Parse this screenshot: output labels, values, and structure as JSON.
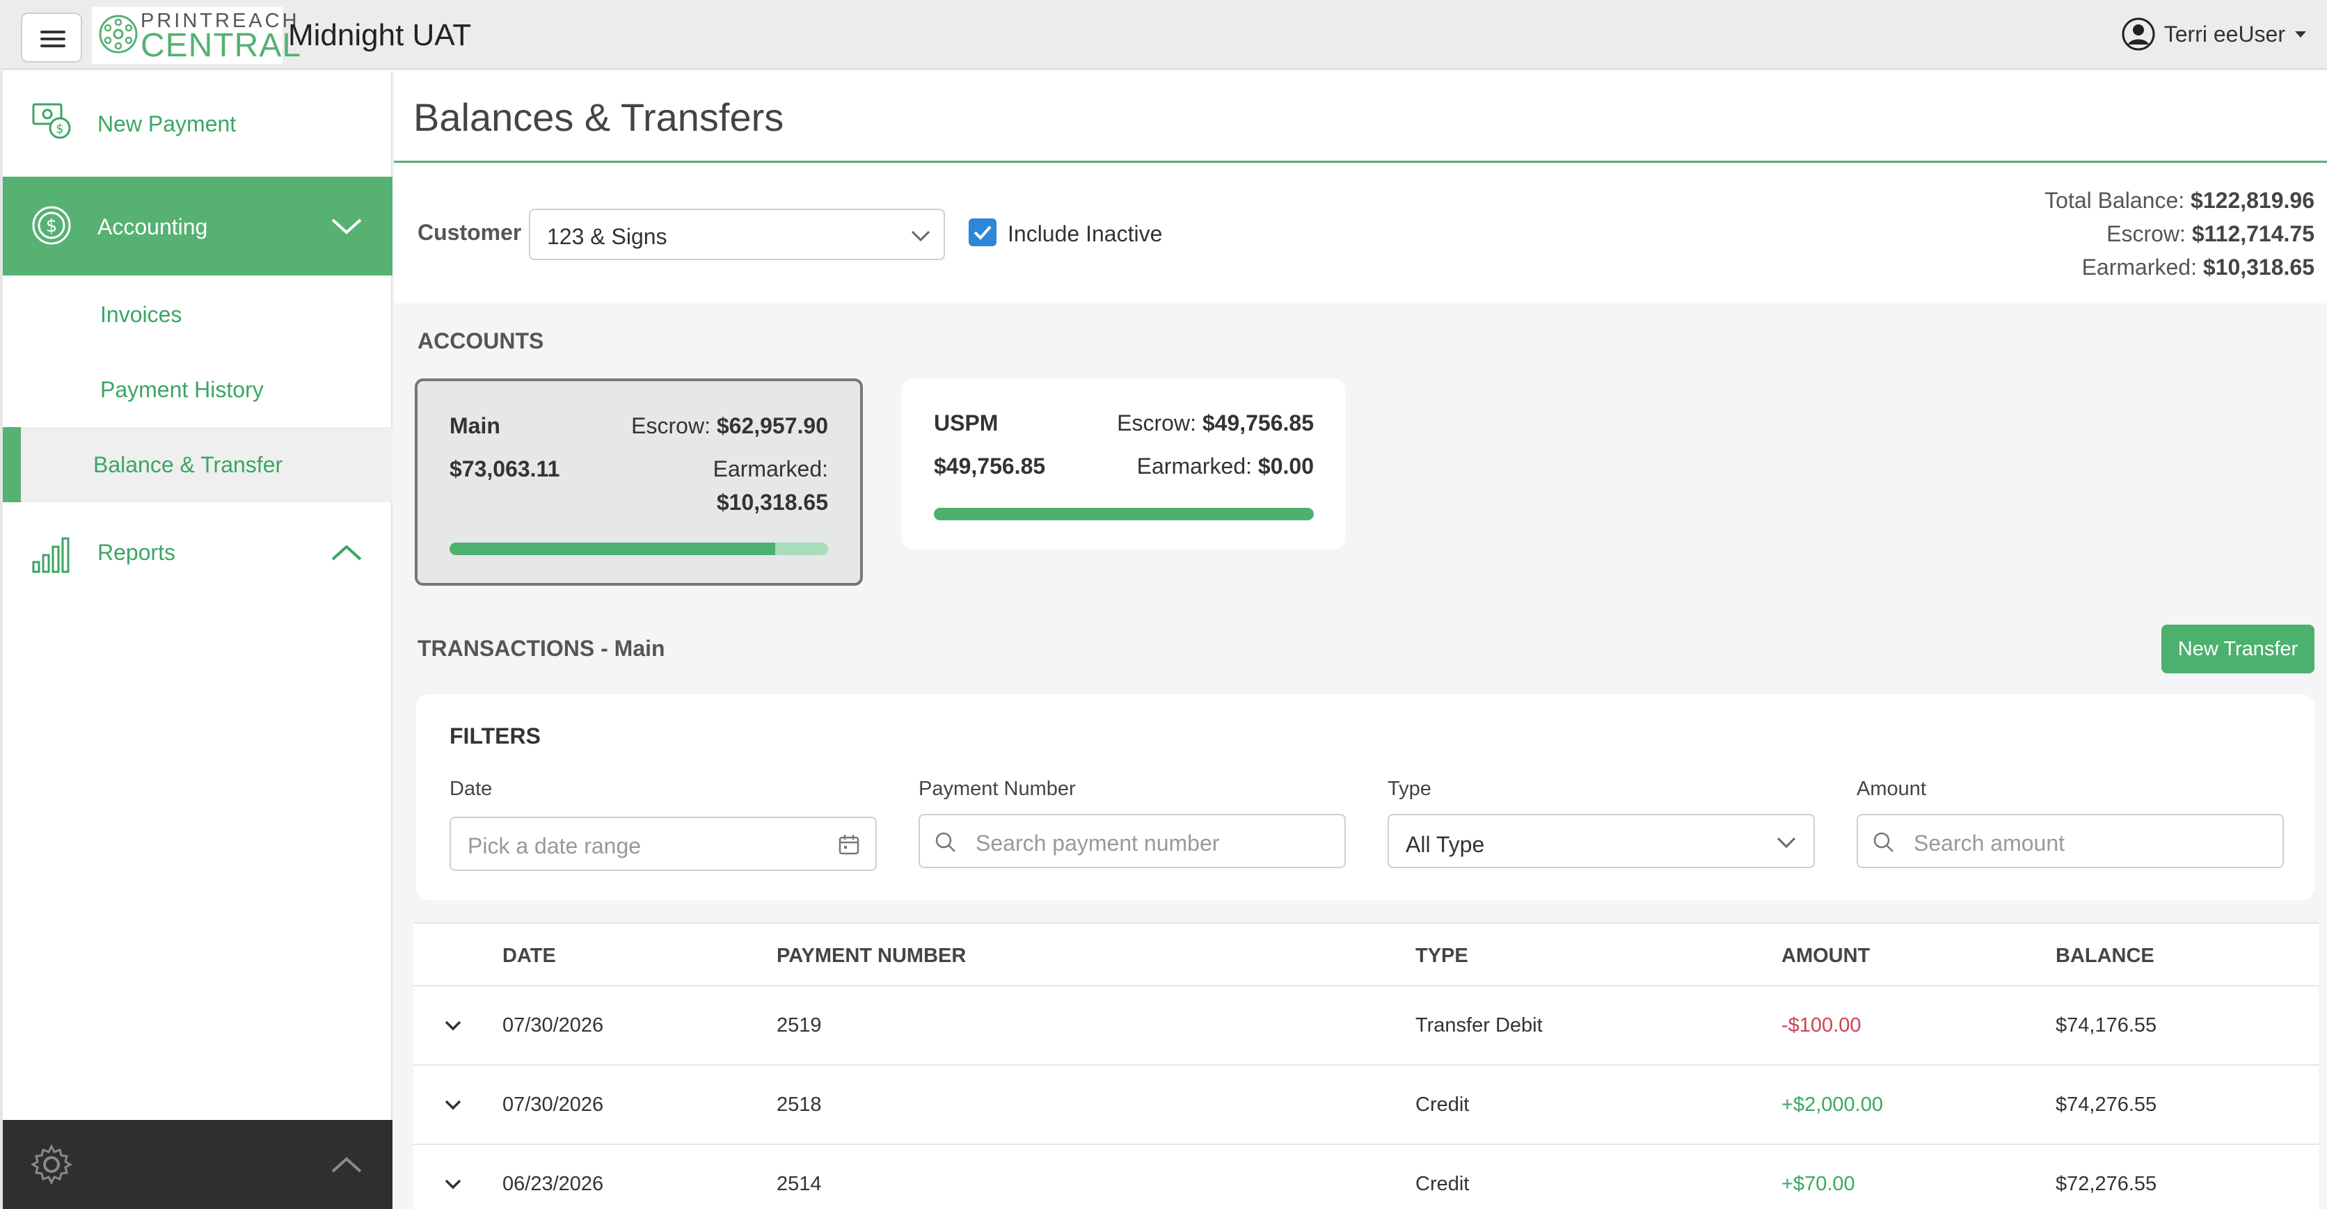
{
  "header": {
    "logo_top": "PRINTREACH",
    "logo_bottom": "CENTRAL",
    "app_name": "Midnight UAT",
    "user_name": "Terri eeUser"
  },
  "sidebar": {
    "new_payment": "New Payment",
    "accounting": "Accounting",
    "sub_items": [
      "Invoices",
      "Payment History",
      "Balance & Transfer"
    ],
    "reports": "Reports"
  },
  "page": {
    "title": "Balances & Transfers",
    "customer_label": "Customer",
    "customer_value": "123 & Signs",
    "include_inactive_label": "Include Inactive",
    "include_inactive_checked": true
  },
  "totals": {
    "total_label": "Total Balance:",
    "total_value": "$122,819.96",
    "escrow_label": "Escrow:",
    "escrow_value": "$112,714.75",
    "earmarked_label": "Earmarked:",
    "earmarked_value": "$10,318.65"
  },
  "accounts": {
    "section_label": "ACCOUNTS",
    "cards": [
      {
        "name": "Main",
        "balance": "$73,063.11",
        "escrow_label": "Escrow:",
        "escrow_value": "$62,957.90",
        "earmarked_label": "Earmarked:",
        "earmarked_value": "$10,318.65",
        "escrow_fraction": 0.86
      },
      {
        "name": "USPM",
        "balance": "$49,756.85",
        "escrow_label": "Escrow:",
        "escrow_value": "$49,756.85",
        "earmarked_label": "Earmarked:",
        "earmarked_value": "$0.00",
        "escrow_fraction": 1.0
      }
    ]
  },
  "transactions": {
    "section_label": "TRANSACTIONS - Main",
    "new_transfer": "New Transfer"
  },
  "filters": {
    "title": "FILTERS",
    "date_label": "Date",
    "date_placeholder": "Pick a date range",
    "payment_label": "Payment Number",
    "payment_placeholder": "Search payment number",
    "type_label": "Type",
    "type_value": "All Type",
    "amount_label": "Amount",
    "amount_placeholder": "Search amount"
  },
  "table": {
    "columns": [
      "DATE",
      "PAYMENT NUMBER",
      "TYPE",
      "AMOUNT",
      "BALANCE"
    ],
    "rows": [
      {
        "date": "07/30/2026",
        "payment": "2519",
        "type": "Transfer Debit",
        "amount": "-$100.00",
        "balance": "$74,176.55"
      },
      {
        "date": "07/30/2026",
        "payment": "2518",
        "type": "Credit",
        "amount": "+$2,000.00",
        "balance": "$74,276.55"
      },
      {
        "date": "06/23/2026",
        "payment": "2514",
        "type": "Credit",
        "amount": "+$70.00",
        "balance": "$72,276.55"
      }
    ]
  },
  "colors": {
    "brand_green": "#56b173",
    "negative_red": "#d0414f",
    "checkbox_blue": "#2f86d6"
  },
  "icons": [
    "menu-icon",
    "printreach-logo",
    "user-circle-icon",
    "cash-icon",
    "dollar-circle-icon",
    "chevron-down-icon",
    "bar-chart-icon",
    "chevron-up-icon",
    "gear-icon",
    "calendar-icon",
    "search-icon",
    "check-icon"
  ]
}
